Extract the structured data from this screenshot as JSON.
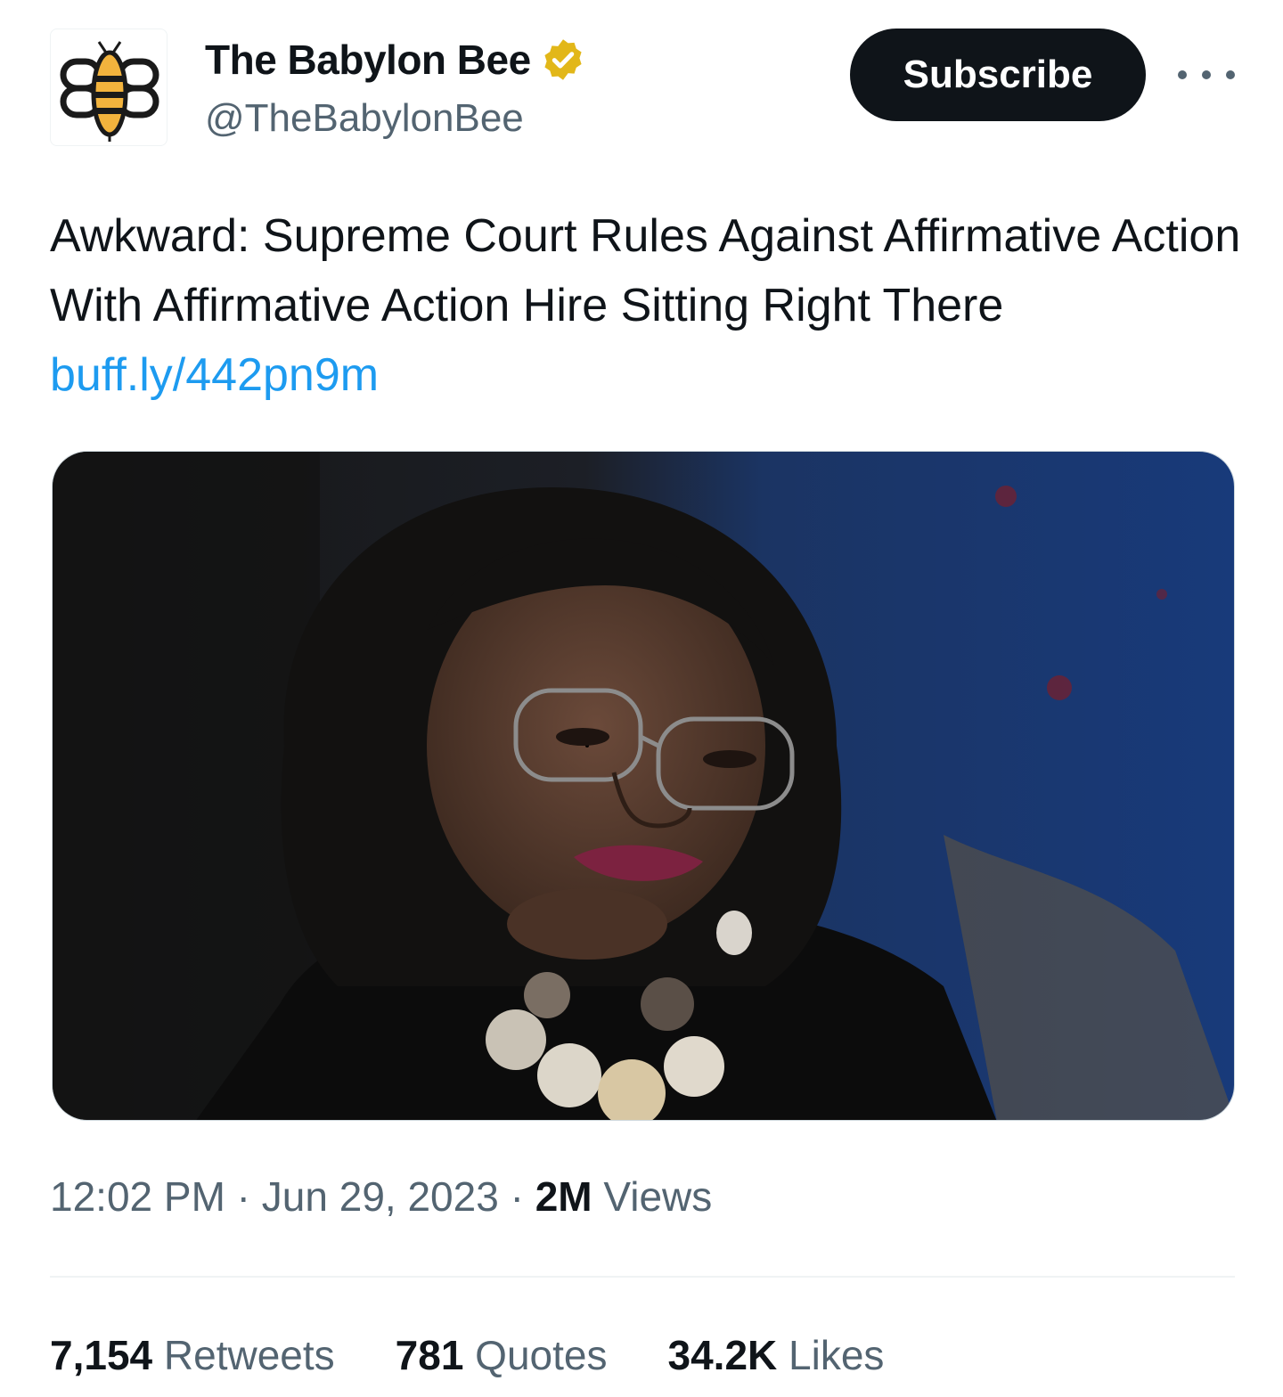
{
  "account": {
    "name": "The Babylon Bee",
    "handle": "@TheBabylonBee",
    "avatar_icon": "babylon-bee-logo",
    "verified_icon": "gold-verified-badge-icon",
    "verified_color": "#e2b719"
  },
  "actions": {
    "subscribe_label": "Subscribe",
    "more_icon": "more-dots-icon"
  },
  "tweet": {
    "text": "Awkward: Supreme Court Rules Against Affirmative Action With Affirmative Action Hire Sitting Right There ",
    "link": "buff.ly/442pn9m",
    "link_color": "#1d9bf0"
  },
  "meta": {
    "time": "12:02 PM",
    "separator": " · ",
    "date": "Jun 29, 2023",
    "views_count": "2M",
    "views_label": " Views"
  },
  "stats": {
    "retweets_count": "7,154",
    "retweets_label": " Retweets",
    "quotes_count": "781",
    "quotes_label": " Quotes",
    "likes_count": "34.2K",
    "likes_label": " Likes"
  }
}
